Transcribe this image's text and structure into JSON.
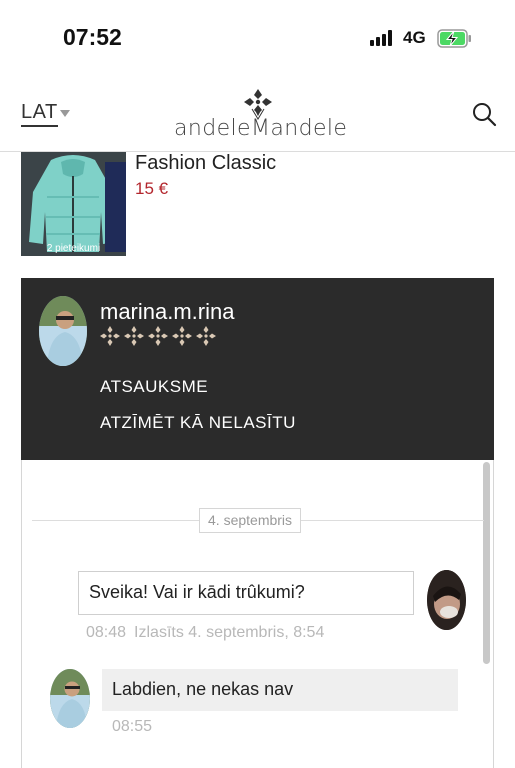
{
  "status_bar": {
    "time": "07:52",
    "network": "4G",
    "signal_icon": "signal-bars-icon",
    "battery_icon": "battery-charging-icon"
  },
  "header": {
    "language": "LAT",
    "logo_text": "andeleMandele",
    "search_icon": "search-icon"
  },
  "product": {
    "title": "Fashion Classic",
    "price": "15 €",
    "thumbnail_caption": "2 pieteikumi",
    "price_color": "#b3262d"
  },
  "user_panel": {
    "username": "marina.m.rina",
    "rating_stars": 5,
    "rating_max": 5,
    "link_review": "ATSAUKSME",
    "link_mark_unread": "ATZĪMĒT KĀ NELASĪTU",
    "background": "#2b2b2b"
  },
  "chat": {
    "date_separator": "4. septembris",
    "messages": [
      {
        "direction": "outgoing",
        "text": "Sveika! Vai ir kādi trûkumi?",
        "time": "08:48",
        "read_status": "Izlasīts 4. septembris, 8:54"
      },
      {
        "direction": "incoming",
        "text": "Labdien, ne nekas nav",
        "time": "08:55"
      }
    ]
  }
}
